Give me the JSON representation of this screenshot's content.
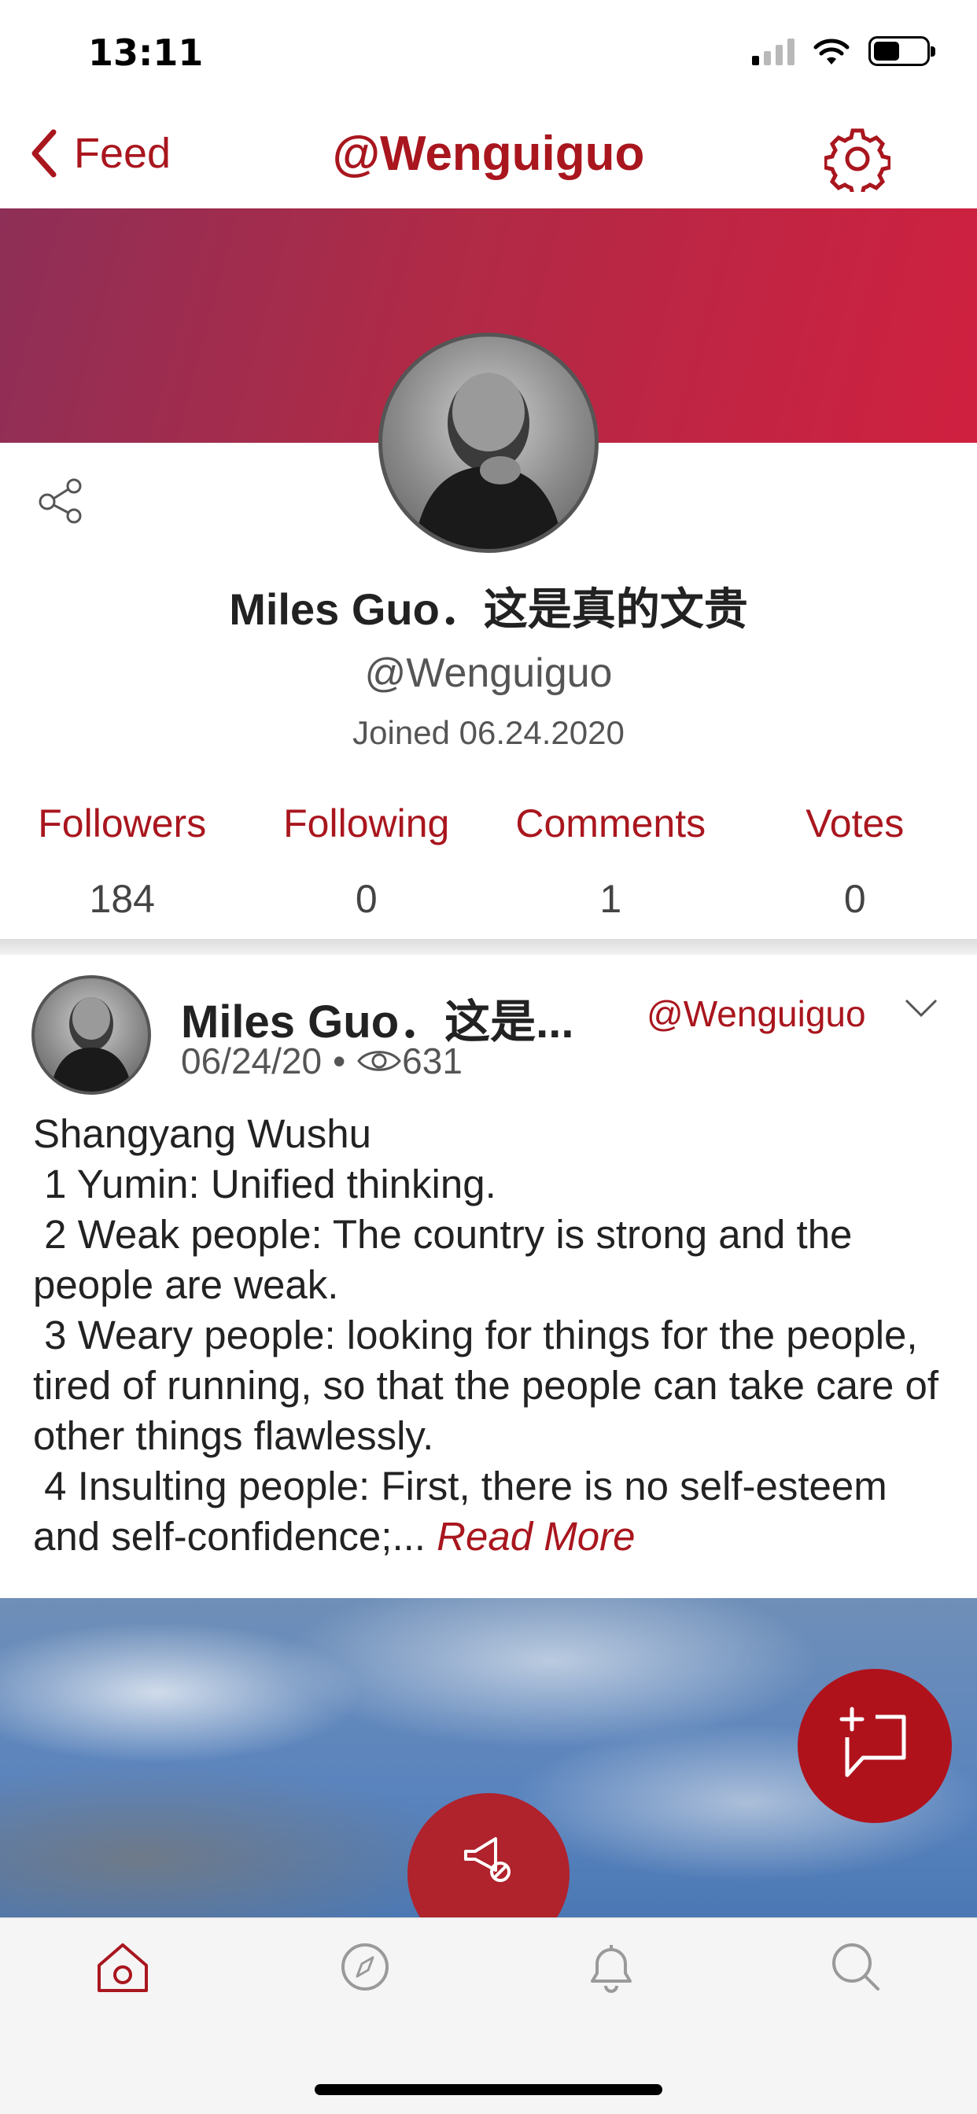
{
  "status_bar": {
    "time": "13:11"
  },
  "nav": {
    "back_label": "Feed",
    "title": "@Wenguiguo"
  },
  "profile": {
    "name": "Miles Guo．这是真的文贵",
    "handle": "@Wenguiguo",
    "joined": "Joined 06.24.2020"
  },
  "stats": [
    {
      "label": "Followers",
      "value": "184"
    },
    {
      "label": "Following",
      "value": "0"
    },
    {
      "label": "Comments",
      "value": "1"
    },
    {
      "label": "Votes",
      "value": "0"
    }
  ],
  "post": {
    "author": "Miles Guo．这是...",
    "handle": "@Wenguiguo",
    "date": "06/24/20",
    "separator": "•",
    "views": "631",
    "body": "Shangyang Wushu\n 1 Yumin: Unified thinking.\n 2 Weak people: The country is strong and the people are weak.\n 3 Weary people: looking for things for the people, tired of running, so that the people can take care of other things flawlessly.\n 4 Insulting people: First, there is no self-esteem and self-confidence;...",
    "read_more": "Read More"
  },
  "tabs": [
    {
      "icon": "home-icon",
      "active": true
    },
    {
      "icon": "compass-icon",
      "active": false
    },
    {
      "icon": "bell-icon",
      "active": false
    },
    {
      "icon": "search-icon",
      "active": false
    }
  ],
  "colors": {
    "accent": "#a9161e",
    "cover_start": "#8e2f57",
    "cover_end": "#d02040",
    "fab": "#b0121c"
  }
}
